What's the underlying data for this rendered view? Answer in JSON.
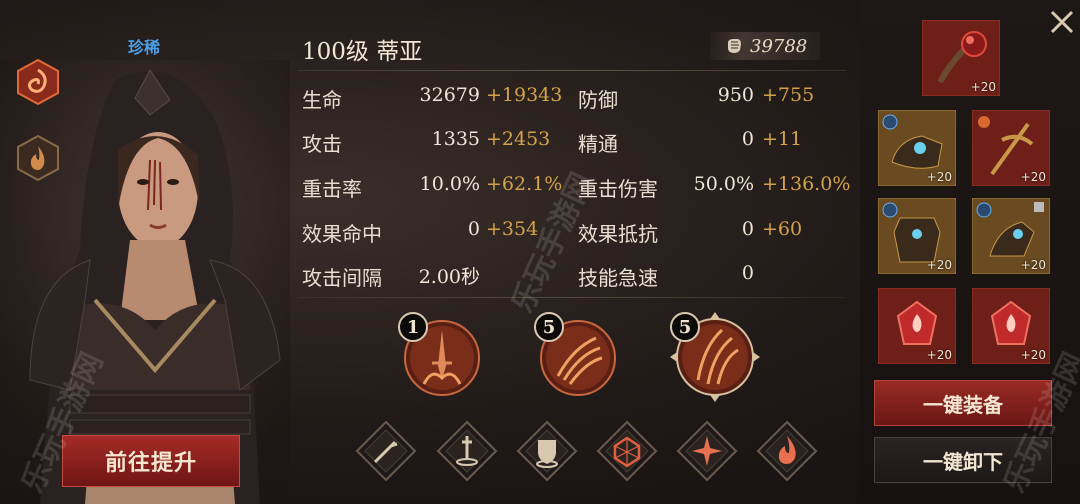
{
  "character": {
    "rarity": "珍稀",
    "title": "100级  蒂亚",
    "power": "39788",
    "upgrade_label": "前往提升"
  },
  "stats": {
    "hp": {
      "label": "生命",
      "value": "32679",
      "bonus": "+19343"
    },
    "defense": {
      "label": "防御",
      "value": "950",
      "bonus": "+755"
    },
    "attack": {
      "label": "攻击",
      "value": "1335",
      "bonus": "+2453"
    },
    "mastery": {
      "label": "精通",
      "value": "0",
      "bonus": "+11"
    },
    "crit_rate": {
      "label": "重击率",
      "value": "10.0%",
      "bonus": "+62.1%"
    },
    "crit_dmg": {
      "label": "重击伤害",
      "value": "50.0%",
      "bonus": "+136.0%"
    },
    "effect_hit": {
      "label": "效果命中",
      "value": "0",
      "bonus": "+354"
    },
    "effect_res": {
      "label": "效果抵抗",
      "value": "0",
      "bonus": "+60"
    },
    "atk_interval": {
      "label": "攻击间隔",
      "value": "2.00秒"
    },
    "skill_haste": {
      "label": "技能急速",
      "value": "0"
    }
  },
  "skills": [
    {
      "level": "1",
      "icon": "sword-flame-icon"
    },
    {
      "level": "5",
      "icon": "claw-slash-icon"
    },
    {
      "level": "5",
      "icon": "fire-slash-icon"
    }
  ],
  "runes": [
    {
      "icon": "sword-icon"
    },
    {
      "icon": "sword-pedestal-icon"
    },
    {
      "icon": "shield-icon"
    },
    {
      "icon": "dice-icon"
    },
    {
      "icon": "star-burst-icon"
    },
    {
      "icon": "flame-icon"
    }
  ],
  "equipment": {
    "weapon": {
      "level": "+20"
    },
    "slot1": {
      "level": "+20"
    },
    "slot2": {
      "level": "+20"
    },
    "slot3": {
      "level": "+20"
    },
    "slot4": {
      "level": "+20"
    },
    "slot5": {
      "level": "+20"
    },
    "slot6": {
      "level": "+20"
    }
  },
  "buttons": {
    "equip_all": "一键装备",
    "unequip_all": "一键卸下"
  },
  "watermark": "乐玩手游网",
  "colors": {
    "accent_red": "#9a2a25",
    "bonus_gold": "#d4a24a",
    "rarity_blue": "#4aa0e8"
  }
}
